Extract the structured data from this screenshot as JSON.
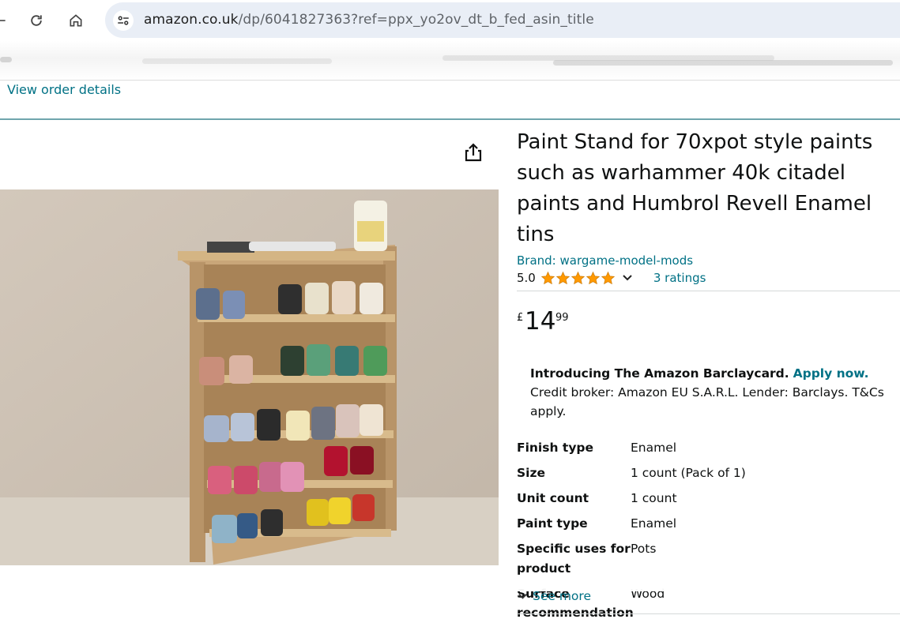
{
  "browser": {
    "url_host": "amazon.co.uk",
    "url_path": "/dp/6041827363?ref=ppx_yo2ov_dt_b_fed_asin_title"
  },
  "page": {
    "view_order_details": "View order details"
  },
  "product": {
    "title": "Paint Stand for 70xpot style paints such as warhammer 40k citadel paints and Humbrol Revell Enamel tins",
    "brand": "Brand: wargame-model-mods",
    "rating_value": "5.0",
    "rating_stars": 5,
    "ratings_count": "3 ratings",
    "price": {
      "symbol": "£",
      "whole": "14",
      "fraction": "99"
    },
    "promo": {
      "intro": "Introducing The Amazon Barclaycard.",
      "apply": "Apply now.",
      "rest": " Credit broker: Amazon EU S.A.R.L. Lender: Barclays. T&Cs apply."
    },
    "specs": [
      {
        "label": "Finish type",
        "value": "Enamel"
      },
      {
        "label": "Size",
        "value": "1 count (Pack of 1)"
      },
      {
        "label": "Unit count",
        "value": "1 count"
      },
      {
        "label": "Paint type",
        "value": "Enamel"
      },
      {
        "label": "Specific uses for product",
        "value": "Pots"
      },
      {
        "label": "Surface recommendation",
        "value": "Wood"
      }
    ],
    "see_more": "See more"
  },
  "colors": {
    "link": "#007185",
    "star": "#ff9900",
    "text": "#0f1111"
  },
  "icons": {
    "back": "arrow-left-icon",
    "reload": "reload-icon",
    "home": "home-icon",
    "site_info": "tune-icon",
    "share": "share-icon",
    "rating_dropdown": "chevron-down-icon",
    "see_more": "chevron-down-icon"
  }
}
